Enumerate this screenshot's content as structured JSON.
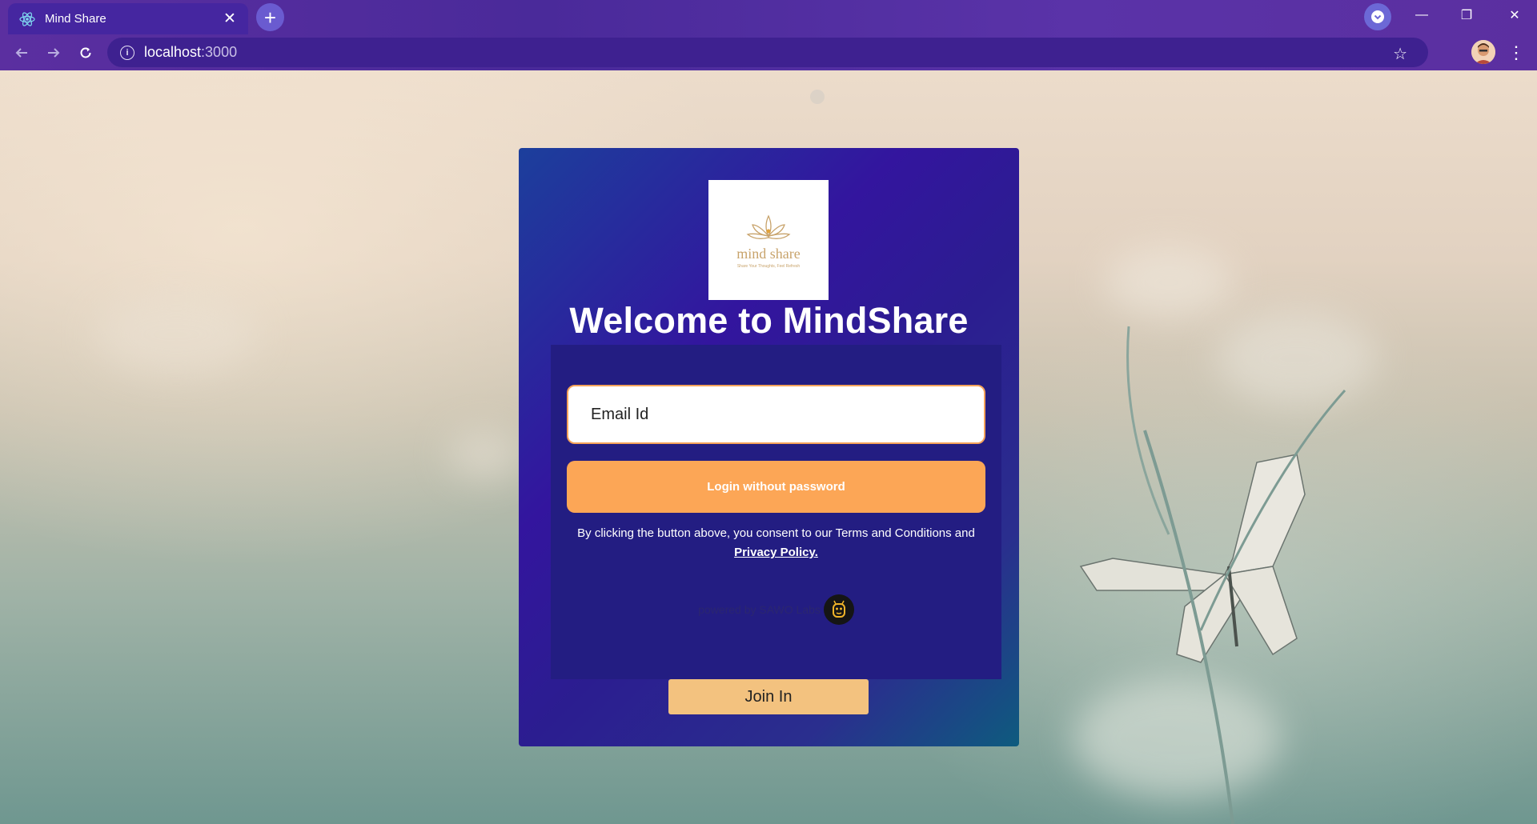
{
  "browser": {
    "tab_title": "Mind Share",
    "tab_close": "✕",
    "new_tab": "+",
    "url_host": "localhost",
    "url_port": ":3000",
    "window_minimize": "—",
    "window_restore": "❐",
    "window_close": "✕"
  },
  "card": {
    "logo_wordmark": "mind share",
    "logo_tagline": "Share Your Thoughts, Feel Refresh",
    "title": "Welcome to MindShare",
    "email_placeholder": "Email Id",
    "login_button": "Login without password",
    "consent_prefix": "By clicking the button above, you consent to our Terms and Conditions and ",
    "privacy_link": "Privacy Policy.",
    "powered_by": "powered by SAWO Labs",
    "join_button": "Join In"
  },
  "colors": {
    "accent_orange": "#fca656",
    "join_button": "#f3c27f",
    "card_purple": "#33159e"
  }
}
